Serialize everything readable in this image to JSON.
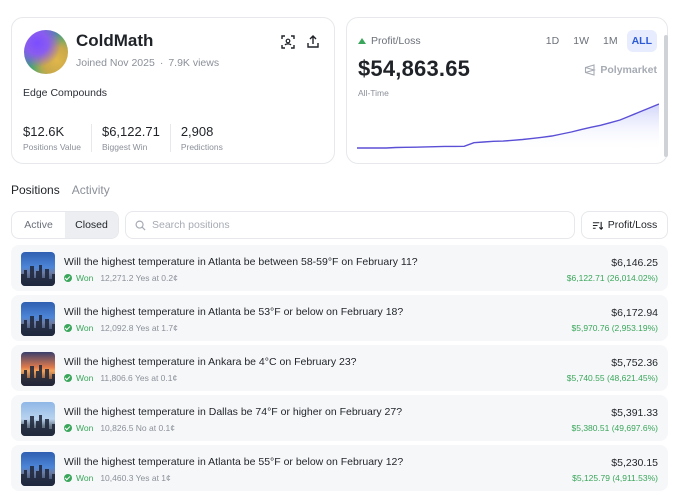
{
  "profile": {
    "name": "ColdMath",
    "joined": "Joined Nov 2025",
    "views": "7.9K views",
    "bio": "Edge Compounds",
    "stats": [
      {
        "value": "$12.6K",
        "label": "Positions Value"
      },
      {
        "value": "$6,122.71",
        "label": "Biggest Win"
      },
      {
        "value": "2,908",
        "label": "Predictions"
      }
    ]
  },
  "pnl": {
    "title": "Profit/Loss",
    "value": "$54,863.65",
    "period": "All-Time",
    "brand": "Polymarket",
    "ranges": [
      "1D",
      "1W",
      "1M",
      "ALL"
    ],
    "active_range": "ALL",
    "accent": "#5b4fd6"
  },
  "chart_data": {
    "type": "area",
    "series": [
      {
        "values": [
          0,
          0,
          0,
          0,
          0.4,
          0.5,
          0.6,
          0.8,
          1,
          1.2,
          1.2,
          1.3,
          4,
          4.5,
          5,
          5.2,
          5.8,
          6.4,
          7.2,
          8,
          9,
          10.5,
          12,
          13.8,
          15.5,
          17,
          19,
          21,
          24,
          27,
          30,
          33
        ]
      }
    ],
    "ylim": [
      0,
      36
    ]
  },
  "tabs": {
    "positions": "Positions",
    "activity": "Activity"
  },
  "filters": {
    "active": "Active",
    "closed": "Closed",
    "search_placeholder": "Search positions",
    "sort_label": "Profit/Loss"
  },
  "positions": [
    {
      "question": "Will the highest temperature in Atlanta be between 58-59°F on February 11?",
      "status": "Won",
      "shares": "12,271.2 Yes at 0.2¢",
      "value": "$6,146.25",
      "gain": "$6,122.71 (26,014.02%)",
      "thumb": "city"
    },
    {
      "question": "Will the highest temperature in Atlanta be 53°F or below on February 18?",
      "status": "Won",
      "shares": "12,092.8 Yes at 1.7¢",
      "value": "$6,172.94",
      "gain": "$5,970.76 (2,953.19%)",
      "thumb": "city"
    },
    {
      "question": "Will the highest temperature in Ankara be 4°C on February 23?",
      "status": "Won",
      "shares": "11,806.6 Yes at 0.1¢",
      "value": "$5,752.36",
      "gain": "$5,740.55 (48,621.45%)",
      "thumb": "sunset"
    },
    {
      "question": "Will the highest temperature in Dallas be 74°F or higher on February 27?",
      "status": "Won",
      "shares": "10,826.5 No at 0.1¢",
      "value": "$5,391.33",
      "gain": "$5,380.51 (49,697.6%)",
      "thumb": "day"
    },
    {
      "question": "Will the highest temperature in Atlanta be 55°F or below on February 12?",
      "status": "Won",
      "shares": "10,460.3 Yes at 1¢",
      "value": "$5,230.15",
      "gain": "$5,125.79 (4,911.53%)",
      "thumb": "city"
    }
  ]
}
